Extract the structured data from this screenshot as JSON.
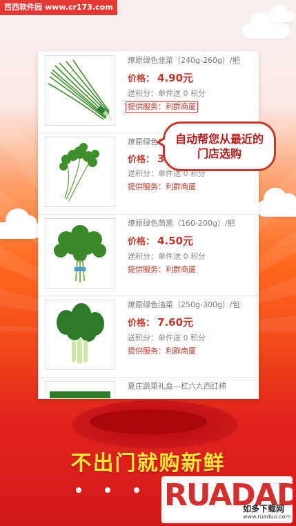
{
  "watermark_top": {
    "site": "西西软件园",
    "url": "www.cr173.com"
  },
  "products": [
    {
      "name": "燎原绿色韭菜（240g-260g）/把",
      "price_label": "价格：",
      "price": "4.90元",
      "points": "送积分：单件送 0 积分",
      "service": "提供服务：利群商厦",
      "image": "chives"
    },
    {
      "name": "燎原绿色香菜",
      "price_label": "价格：",
      "price": "3.60",
      "points": "送积分：单件送 0 积分",
      "service": "提供服务：利群商厦",
      "image": "cilantro"
    },
    {
      "name": "燎原绿色茼蒿（160-200g）/把",
      "price_label": "价格：",
      "price": "4.50元",
      "points": "送积分：单件送 0 积分",
      "service": "提供服务：利群商厦",
      "image": "crown-daisy"
    },
    {
      "name": "燎原绿色油菜（250g-300g）/包",
      "price_label": "价格：",
      "price": "7.60元",
      "points": "送积分：单件送 0 积分",
      "service": "提供服务：利群商厦",
      "image": "bok-choy"
    },
    {
      "name": "夏庄蔬菜礼盒—杠六九西红柿",
      "image": "tomato-box"
    }
  ],
  "bubble": {
    "text": "自动帮您从最近的门店选购"
  },
  "slogan": "不出门就购新鲜",
  "watermark_bottom": {
    "logo_text": "RUADADO",
    "cn": "如多下载网",
    "url": "www.ruaduo.com"
  },
  "colors": {
    "accent_red": "#c0392b",
    "slogan_yellow": "#ffe83a"
  }
}
